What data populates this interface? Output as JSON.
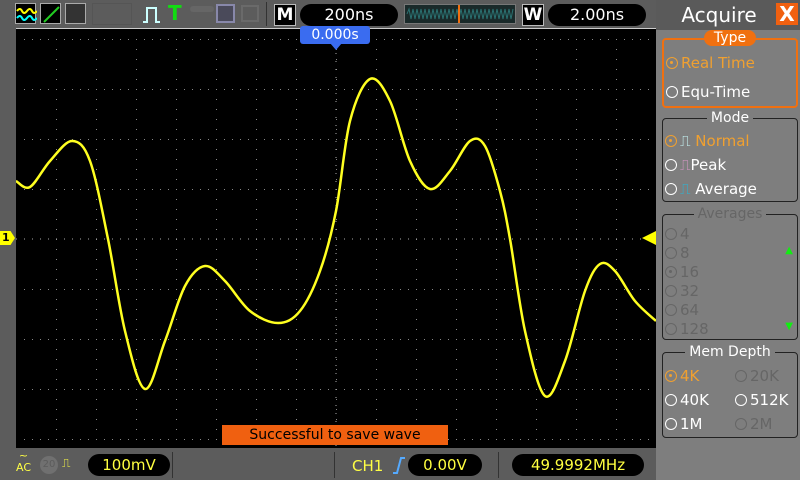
{
  "toolbar": {
    "timebase": "200ns",
    "mode_m": "M",
    "mode_w": "W",
    "window_timebase": "2.00ns"
  },
  "screen": {
    "trigger_position": "0.000s",
    "channel_marker": "1",
    "toast": "Successful to save wave"
  },
  "status": {
    "coupling": "AC",
    "bw_limit": "20",
    "volts_div": "100mV",
    "trigger_source": "CH1",
    "trigger_level": "0.00V",
    "frequency": "49.9992MHz"
  },
  "panel": {
    "title": "Acquire",
    "close": "X",
    "type": {
      "label": "Type",
      "options": [
        "Real Time",
        "Equ-Time"
      ],
      "selected": "Real Time"
    },
    "mode": {
      "label": "Mode",
      "options": [
        "Normal",
        "Peak",
        "Average"
      ],
      "selected": "Normal"
    },
    "averages": {
      "label": "Averages",
      "options": [
        "4",
        "8",
        "16",
        "32",
        "64",
        "128"
      ],
      "selected": "16"
    },
    "mem_depth": {
      "label": "Mem Depth",
      "options": [
        "4K",
        "20K",
        "40K",
        "512K",
        "1M",
        "2M"
      ],
      "selected": "4K"
    }
  },
  "colors": {
    "trace": "#ffff20",
    "accent": "#f07010",
    "trigger_marker": "#3a6cf0"
  }
}
